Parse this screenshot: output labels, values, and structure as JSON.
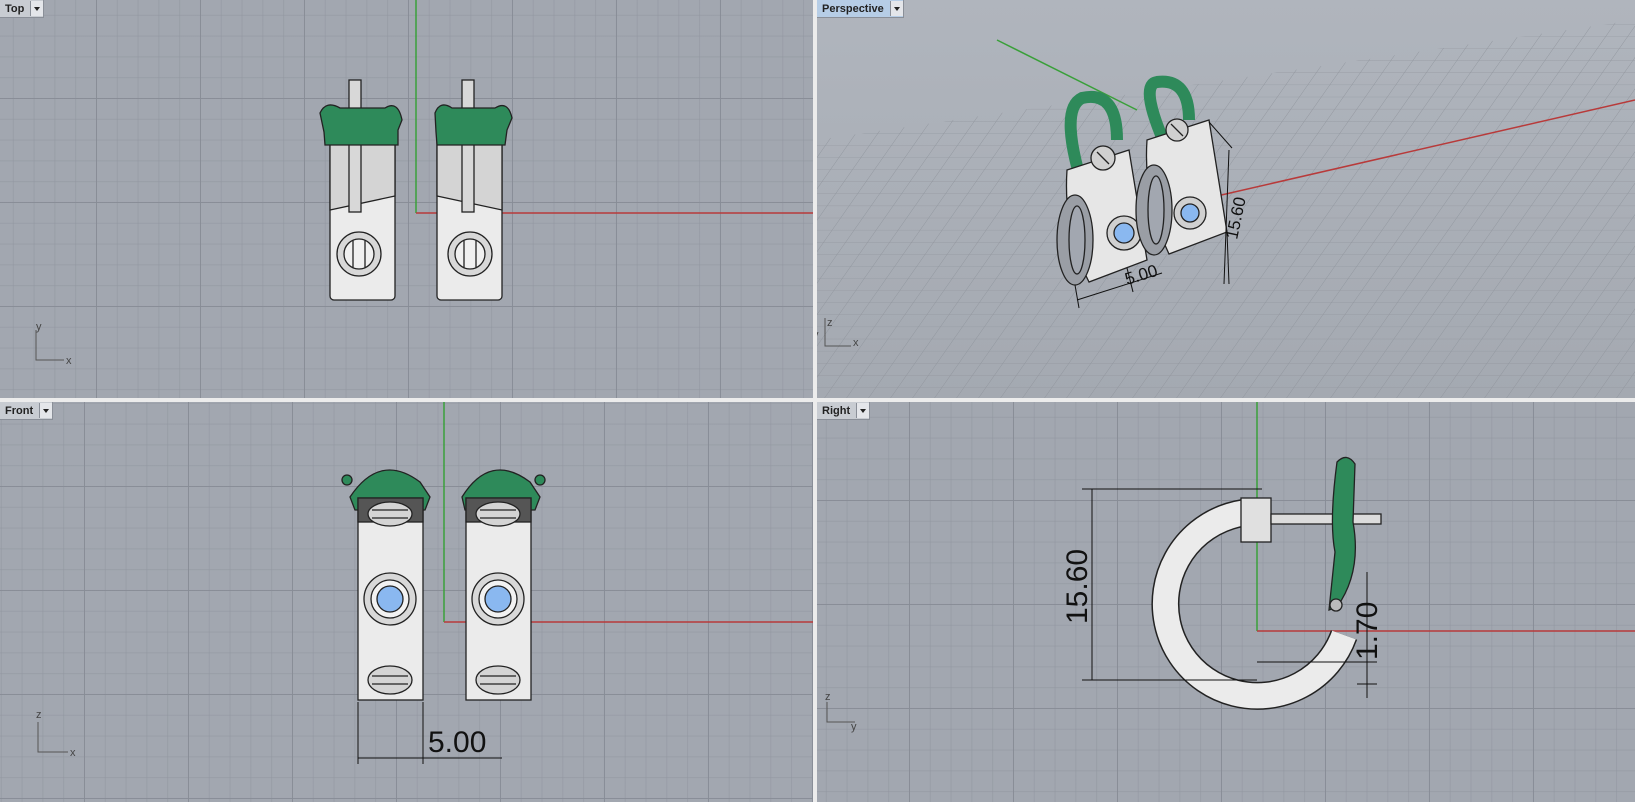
{
  "viewports": {
    "top": {
      "label": "Top",
      "axes": {
        "a": "y",
        "b": "x"
      }
    },
    "perspective": {
      "label": "Perspective",
      "axes": {
        "a": "y",
        "b": "z",
        "c": "x"
      },
      "dims": {
        "width": "5.00",
        "height": "15.60"
      }
    },
    "front": {
      "label": "Front",
      "axes": {
        "a": "z",
        "b": "x"
      },
      "dims": {
        "width": "5.00"
      }
    },
    "right": {
      "label": "Right",
      "axes": {
        "a": "z",
        "b": "y"
      },
      "dims": {
        "height": "15.60",
        "offset": "1.70"
      }
    }
  },
  "colors": {
    "x_axis": "#b83a3a",
    "y_axis": "#3aa03a",
    "clasp": "#2e8a5a",
    "gem": "#8ab8f0",
    "metal": "#ebebeb"
  }
}
